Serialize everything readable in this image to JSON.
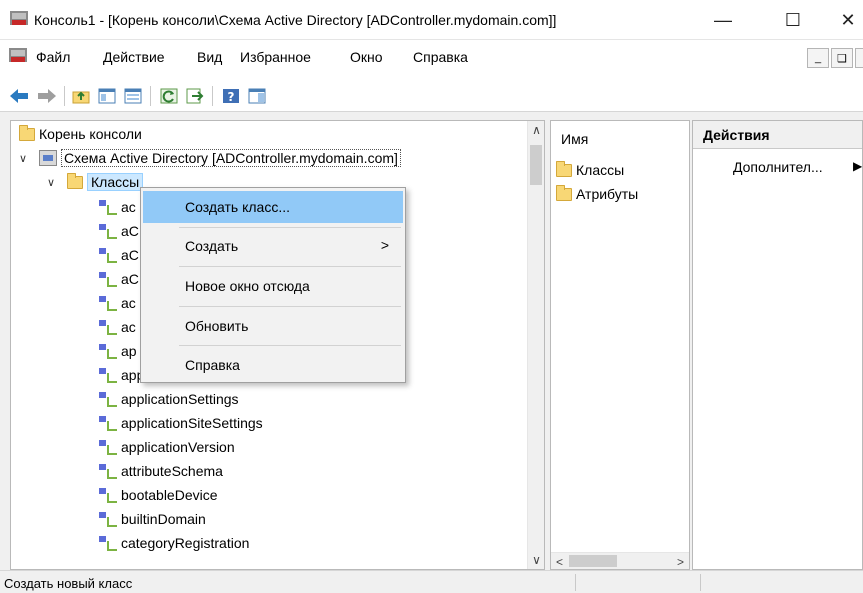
{
  "window": {
    "title": "Консоль1 - [Корень консоли\\Схема Active Directory [ADController.mydomain.com]]",
    "minimize_glyph": "—",
    "maximize_glyph": "☐",
    "close_glyph": "✕"
  },
  "menu": {
    "file": "Файл",
    "action": "Действие",
    "view": "Вид",
    "favorites": "Избранное",
    "window": "Окно",
    "help": "Справка"
  },
  "tree": {
    "console_root": "Корень консоли",
    "schema_node": "Схема Active Directory [ADController.mydomain.com]",
    "classes_node": "Классы",
    "partial_items": [
      "ac",
      "aC",
      "aC",
      "aC",
      "ac",
      "ac",
      "ap",
      "applicationProcess"
    ],
    "items": [
      "applicationSettings",
      "applicationSiteSettings",
      "applicationVersion",
      "attributeSchema",
      "bootableDevice",
      "builtinDomain",
      "categoryRegistration"
    ]
  },
  "list": {
    "column_name": "Имя",
    "rows": [
      "Классы",
      "Атрибуты"
    ]
  },
  "actions": {
    "header": "Действия",
    "more": "Дополнител..."
  },
  "context_menu": {
    "create_class": "Создать класс...",
    "create": "Создать",
    "new_window": "Новое окно отсюда",
    "refresh": "Обновить",
    "help": "Справка"
  },
  "status": {
    "text": "Создать новый класс"
  },
  "colors": {
    "menu_highlight": "#91c9f7",
    "selection": "#cce8ff",
    "folder": "#f8d775"
  }
}
